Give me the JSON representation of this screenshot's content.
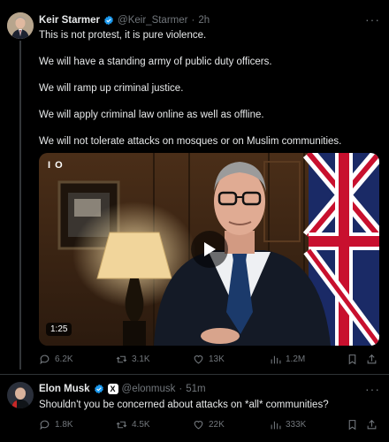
{
  "tweet1": {
    "author": "Keir Starmer",
    "handle": "@Keir_Starmer",
    "separator": "·",
    "time": "2h",
    "more": "···",
    "lines": [
      "This is not protest, it is pure violence.",
      "We will have a standing army of public duty officers.",
      "We will ramp up criminal justice.",
      "We will apply criminal law online as well as offline.",
      "We will not tolerate attacks on mosques or on Muslim communities."
    ],
    "video": {
      "playback_indicator": "I O",
      "duration": "1:25"
    },
    "stats": {
      "replies": "6.2K",
      "reposts": "3.1K",
      "likes": "13K",
      "views": "1.2M"
    }
  },
  "tweet2": {
    "author": "Elon Musk",
    "handle": "@elonmusk",
    "separator": "·",
    "time": "51m",
    "xbadge": "X",
    "more": "···",
    "text": "Shouldn't you be concerned about attacks on *all* communities?",
    "stats": {
      "replies": "1.8K",
      "reposts": "4.5K",
      "likes": "22K",
      "views": "333K"
    }
  },
  "colors": {
    "background": "#000000",
    "text": "#e7e9ea",
    "muted": "#71767b",
    "verified": "#1d9bf0",
    "divider": "#2f3336"
  }
}
